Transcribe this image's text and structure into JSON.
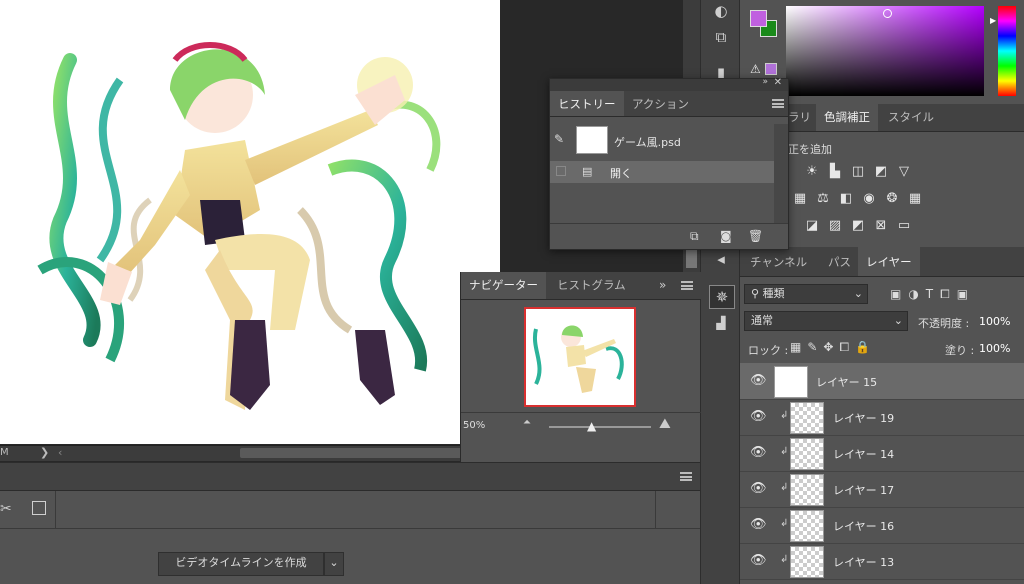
{
  "workspace": {
    "status_left": "M",
    "zoom_small_label": "50%"
  },
  "timeline": {
    "create_button": "ビデオタイムラインを作成"
  },
  "history": {
    "tabs": [
      "ヒストリー",
      "アクション"
    ],
    "snapshot_name": "ゲーム風.psd",
    "items": [
      {
        "label": "開く"
      }
    ]
  },
  "navigator": {
    "tabs": [
      "ナビゲーター",
      "ヒストグラム"
    ],
    "zoom": "50%"
  },
  "adjustments": {
    "tabs": [
      "ラリ",
      "色調補正",
      "スタイル"
    ],
    "add_label": "正を追加"
  },
  "layers": {
    "tabs": [
      "チャンネル",
      "パス",
      "レイヤー"
    ],
    "filter_kind": "種類",
    "blend_mode": "通常",
    "opacity_label": "不透明度 :",
    "opacity_value": "100%",
    "lock_label": "ロック :",
    "fill_label": "塗り :",
    "fill_value": "100%",
    "rows": [
      {
        "name": "レイヤー 15"
      },
      {
        "name": "レイヤー 19"
      },
      {
        "name": "レイヤー 14"
      },
      {
        "name": "レイヤー 17"
      },
      {
        "name": "レイヤー 16"
      },
      {
        "name": "レイヤー 13"
      }
    ]
  },
  "colors": {
    "foreground": "#c060e0",
    "background": "#1a8a1a",
    "accent": "#d83030"
  }
}
